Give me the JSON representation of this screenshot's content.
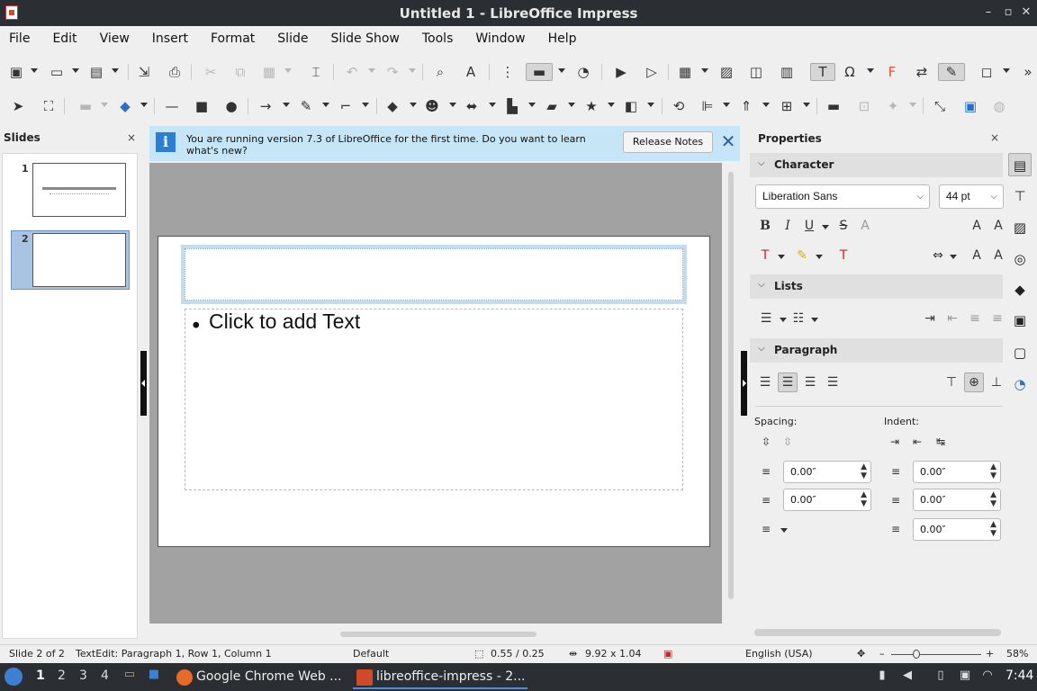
{
  "window": {
    "title": "Untitled 1 - LibreOffice Impress"
  },
  "menu": [
    "File",
    "Edit",
    "View",
    "Insert",
    "Format",
    "Slide",
    "Slide Show",
    "Tools",
    "Window",
    "Help"
  ],
  "slides_pane": {
    "title": "Slides",
    "close": "×",
    "slides": [
      {
        "number": "1"
      },
      {
        "number": "2"
      }
    ]
  },
  "infobar": {
    "message": "You are running version 7.3 of LibreOffice for the first time. Do you want to learn what's new?",
    "button": "Release Notes",
    "close": "✕"
  },
  "slide": {
    "content_placeholder": "Click to add Text",
    "bullet": "•"
  },
  "properties": {
    "title": "Properties",
    "close": "×",
    "sections": {
      "character": "Character",
      "lists": "Lists",
      "paragraph": "Paragraph"
    },
    "font_name": "Liberation Sans",
    "font_size": "44 pt",
    "spacing_label": "Spacing:",
    "indent_label": "Indent:",
    "spacing_above": "0.00″",
    "spacing_below": "0.00″",
    "indent_before": "0.00″",
    "indent_after": "0.00″",
    "indent_first": "0.00″"
  },
  "statusbar": {
    "slide": "Slide 2 of 2",
    "edit": "TextEdit: Paragraph 1, Row 1, Column 1",
    "layout": "Default",
    "position": "0.55 / 0.25",
    "size": "9.92 x 1.04",
    "language": "English (USA)",
    "zoom": "58%"
  },
  "taskbar": {
    "workspaces": [
      "1",
      "2",
      "3",
      "4"
    ],
    "tasks": [
      "Google Chrome Web ...",
      "libreoffice-impress - 2..."
    ],
    "clock": "7:44"
  },
  "colors": {
    "accent": "#4a8fd8",
    "infobar_bg": "#c6e6f7",
    "workspace_bg": "#a2a2a2",
    "titlebar_bg": "#2b2f33"
  }
}
